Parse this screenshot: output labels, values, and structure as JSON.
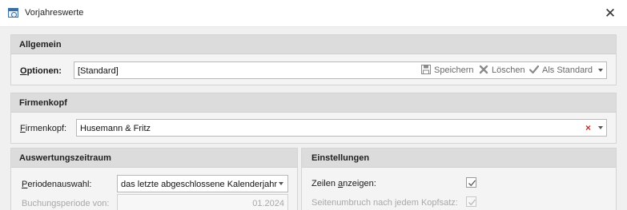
{
  "window": {
    "title": "Vorjahreswerte"
  },
  "allgemein": {
    "header": "Allgemein",
    "options_label_u": "O",
    "options_label_rest": "ptionen:",
    "options_value": "[Standard]",
    "save_label": "Speichern",
    "delete_label": "Löschen",
    "default_label": "Als Standard"
  },
  "firmenkopf": {
    "header": "Firmenkopf",
    "label_u": "F",
    "label_rest": "irmenkopf:",
    "value": "Husemann & Fritz"
  },
  "auswertung": {
    "header": "Auswertungszeitraum",
    "period_label_u": "P",
    "period_label_rest": "eriodenauswahl:",
    "period_value": "das letzte abgeschlossene Kalenderjahr",
    "booking_label": "Buchungsperiode von:",
    "booking_value": "01.2024"
  },
  "einstellungen": {
    "header": "Einstellungen",
    "rows_label_a": "Zeilen ",
    "rows_label_u": "a",
    "rows_label_b": "nzeigen:",
    "rows_checked": true,
    "pagebreak_label": "Seitenumbruch nach jedem Kopfsatz:",
    "pagebreak_checked": true
  }
}
